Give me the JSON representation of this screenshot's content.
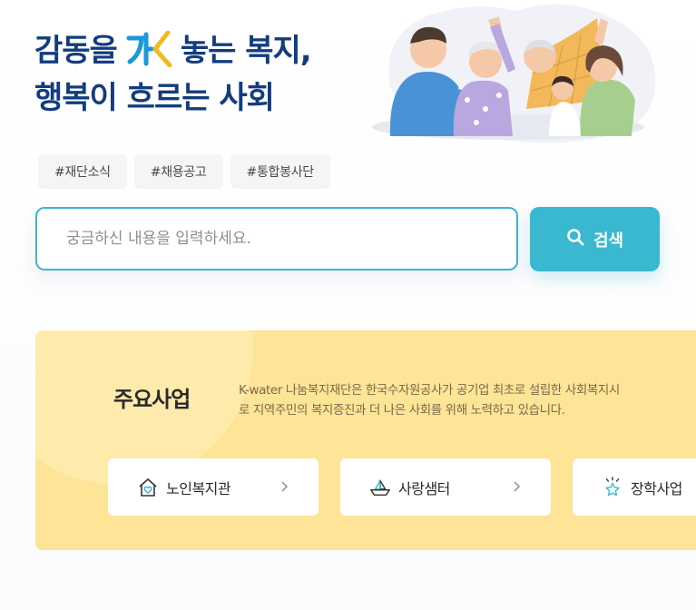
{
  "hero": {
    "line1_before": "감동을",
    "line1_after": "놓는 복지,",
    "line2": "행복이 흐르는 사회",
    "logo_letters": "가K"
  },
  "tags": [
    "#재단소식",
    "#채용공고",
    "#통합봉사단"
  ],
  "search": {
    "placeholder": "궁금하신 내용을 입력하세요.",
    "button_label": "검색"
  },
  "main_business": {
    "title": "주요사업",
    "description_line1": "K-water 나눔복지재단은 한국수자원공사가 공기업 최초로 설립한 사회복지시",
    "description_line2": "로 지역주민의 복지증진과 더 나은 사회를 위해 노력하고 있습니다.",
    "cards": [
      {
        "label": "노인복지관",
        "icon": "house-heart-icon"
      },
      {
        "label": "사랑샘터",
        "icon": "boat-icon"
      },
      {
        "label": "장학사업",
        "icon": "star-icon"
      }
    ]
  },
  "colors": {
    "headline": "#133c7e",
    "accent": "#39b8cf",
    "logo_blue": "#1a9ad8",
    "logo_yellow": "#f3b91d",
    "panel": "#fde497"
  }
}
